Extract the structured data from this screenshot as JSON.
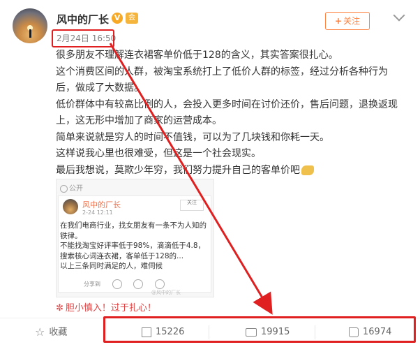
{
  "header": {
    "username": "风中的厂长",
    "verified_badge": "V",
    "level_badge": "会",
    "timestamp": "2月24日 16:50",
    "follow_label": "关注",
    "follow_plus": "+"
  },
  "post": {
    "lines": [
      "很多朋友不理解连衣裙客单价低于128的含义，其实答案很扎心。",
      "这个消费区间的人群，被淘宝系统打上了低价人群的标签，经过分析各种行为",
      "后，做成了大数据。",
      "低价群体中有较高比例的人，会投入更多时间在讨价还价，售后问题，退换返现",
      "上，这无形中增加了商家的运营成本。",
      "简单来说就是穷人的时间不值钱，可以为了几块钱和你耗一天。",
      "这样说我心里也很难受，但这是一个社会现实。",
      "最后我想说，莫欺少年穷，我们努力提升自己的客单价吧"
    ]
  },
  "repost": {
    "visibility": "公开",
    "inner_name": "风中的厂长",
    "inner_time": "2-24 12:11",
    "inner_follow": "关注",
    "inner_lines": [
      "在我们电商行业，找女朋友有一条不为人知的",
      "铁律。",
      "不能找淘宝好评率低于98%，滴滴低于4.8，",
      "搜索核心词连衣裙，客单低于128的...",
      "以上三条同时满足的人，难伺候"
    ],
    "share_label": "分享到",
    "watermark": "@风中的厂长"
  },
  "caption": {
    "icon": "✼",
    "text": "胆小慎入！过于扎心！"
  },
  "actions": {
    "favorite_label": "收藏",
    "repost_count": "15226",
    "comment_count": "19915",
    "like_count": "16974"
  },
  "colors": {
    "accent_orange": "#ff8140",
    "annotation_red": "#e02020",
    "caption_red": "#e24040"
  },
  "icons": [
    "avatar",
    "verified-icon",
    "level-icon",
    "chevron-down-icon",
    "flex-arm-emoji",
    "globe-icon",
    "star-icon",
    "share-icon",
    "comment-icon",
    "like-icon"
  ]
}
